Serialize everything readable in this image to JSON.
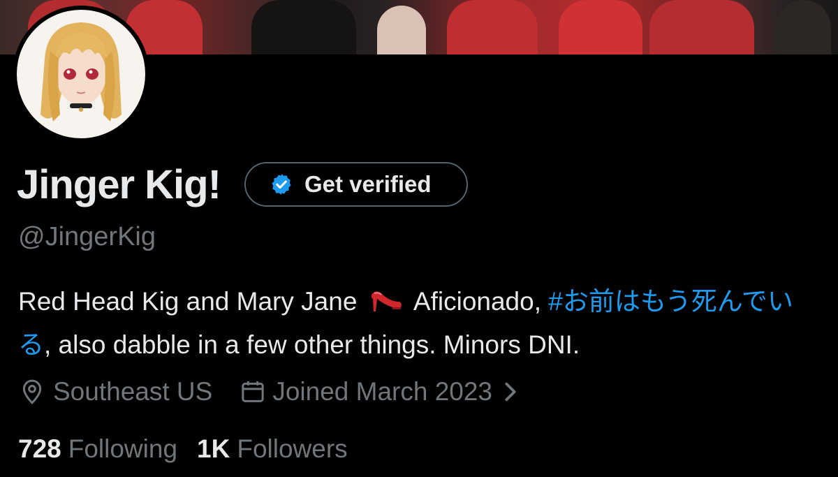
{
  "profile": {
    "display_name": "Jinger Kig!",
    "handle": "@JingerKig",
    "verify_button_label": "Get verified",
    "bio": {
      "text_1": "Red Head Kig and Mary Jane",
      "emoji_name": "high-heel-icon",
      "text_2": "Aficionado,",
      "hashtag": "#お前はもう死んでいる",
      "text_3": ", also dabble in a few other things. Minors DNI."
    },
    "location": "Southeast US",
    "joined": "Joined March 2023",
    "following_count": "728",
    "following_label": "Following",
    "followers_count": "1K",
    "followers_label": "Followers"
  },
  "colors": {
    "background": "#000000",
    "text_primary": "#e7e9ea",
    "text_secondary": "#71767b",
    "link": "#1d9bf0",
    "verified_badge": "#1d9bf0"
  }
}
